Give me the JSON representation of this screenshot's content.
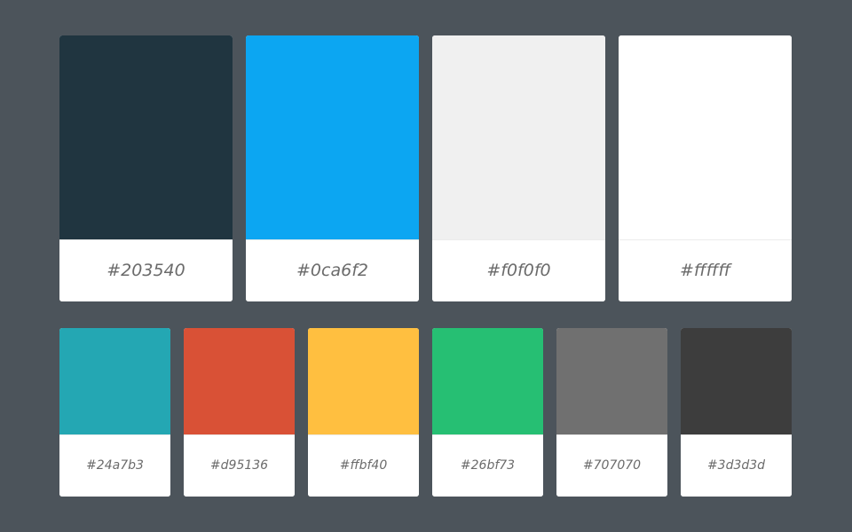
{
  "primary_colors": [
    {
      "hex": "#203540",
      "label": "#203540"
    },
    {
      "hex": "#0ca6f2",
      "label": "#0ca6f2"
    },
    {
      "hex": "#f0f0f0",
      "label": "#f0f0f0"
    },
    {
      "hex": "#ffffff",
      "label": "#ffffff"
    }
  ],
  "secondary_colors": [
    {
      "hex": "#24a7b3",
      "label": "#24a7b3"
    },
    {
      "hex": "#d95136",
      "label": "#d95136"
    },
    {
      "hex": "#ffbf40",
      "label": "#ffbf40"
    },
    {
      "hex": "#26bf73",
      "label": "#26bf73"
    },
    {
      "hex": "#707070",
      "label": "#707070"
    },
    {
      "hex": "#3d3d3d",
      "label": "#3d3d3d"
    }
  ]
}
